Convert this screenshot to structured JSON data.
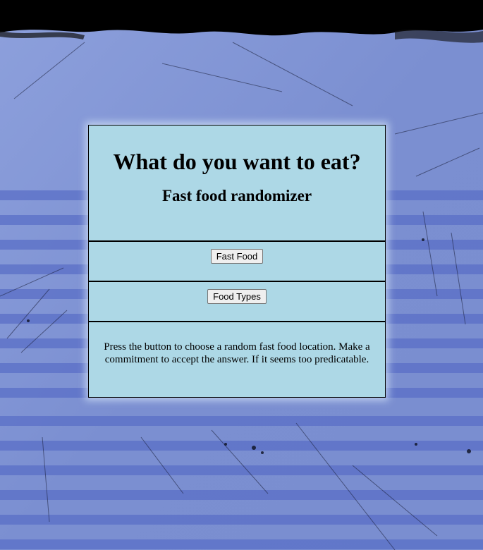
{
  "header": {
    "title": "What do you want to eat?",
    "subtitle": "Fast food randomizer"
  },
  "buttons": {
    "fast_food": "Fast Food",
    "food_types": "Food Types"
  },
  "description": "Press the button to choose a random fast food location. Make a commitment to accept the answer. If it seems too predicatable.",
  "colors": {
    "background": "#7f93d3",
    "panel": "#add8e6",
    "stripe": "#5a6fc7",
    "top_band": "#000000"
  }
}
